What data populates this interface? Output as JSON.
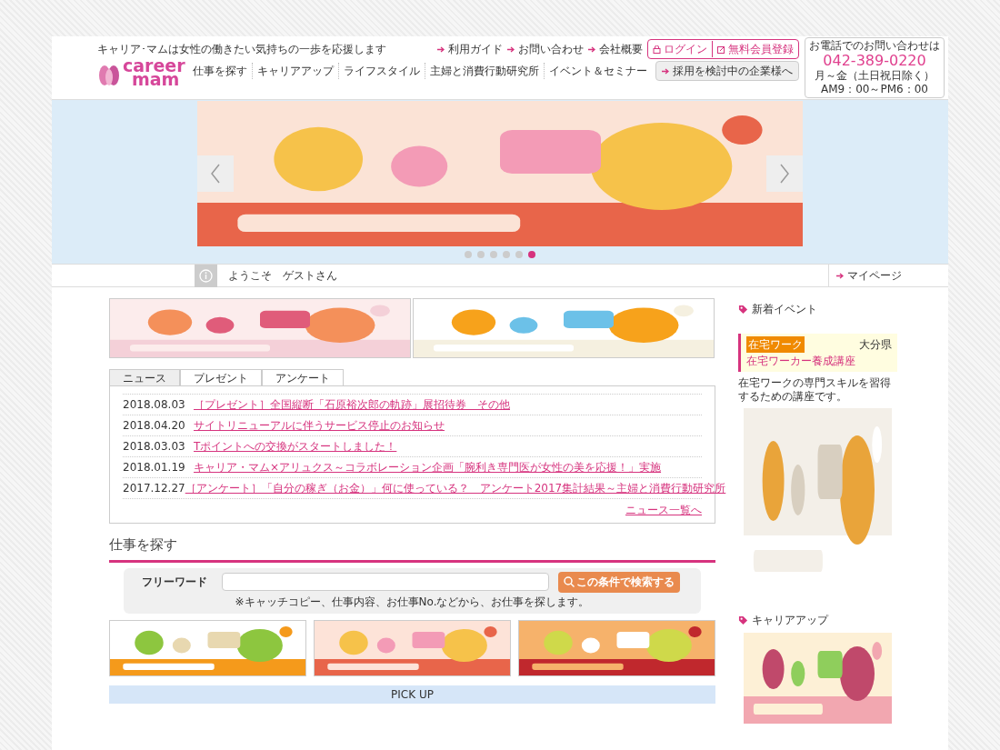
{
  "header": {
    "tagline": "キャリア･マムは女性の働きたい気持ちの一歩を応援します",
    "logo": [
      "career",
      "mam"
    ],
    "top_links": [
      "利用ガイド",
      "お問い合わせ",
      "会社概要"
    ],
    "login": "ログイン",
    "register": "無料会員登録",
    "nav": [
      "仕事を探す",
      "キャリアアップ",
      "ライフスタイル",
      "主婦と消費行動研究所",
      "イベント＆セミナー"
    ],
    "company_button": "採用を検討中の企業様へ",
    "contact": {
      "title": "お電話でのお問い合わせは",
      "phone": "042-389-0220",
      "days": "月～金（土日祝日除く）",
      "hours": "AM9：00～PM6：00"
    }
  },
  "carousel": {
    "dots": [
      {
        "selected": false
      },
      {
        "selected": false
      },
      {
        "selected": false
      },
      {
        "selected": false
      },
      {
        "selected": false
      },
      {
        "selected": true
      }
    ]
  },
  "welcome": {
    "text": "ようこそ　ゲストさん",
    "mypage": "マイページ"
  },
  "tabs": [
    {
      "label": "ニュース",
      "selected": true
    },
    {
      "label": "プレゼント",
      "selected": false
    },
    {
      "label": "アンケート",
      "selected": false
    }
  ],
  "news": [
    {
      "date": "2018.08.03",
      "title": "［プレゼント］全国縦断「石原裕次郎の軌跡」展招待券　その他"
    },
    {
      "date": "2018.04.20",
      "title": "サイトリニューアルに伴うサービス停止のお知らせ"
    },
    {
      "date": "2018.03.03",
      "title": "Tポイントへの交換がスタートしました！"
    },
    {
      "date": "2018.01.19",
      "title": "キャリア・マム×アリュクス～コラボレーション企画「腕利き専門医が女性の美を応援！」実施"
    },
    {
      "date": "2017.12.27",
      "title": "［アンケート］「自分の稼ぎ（お金）」何に使っている？　アンケート2017集計結果～主婦と消費行動研究所"
    }
  ],
  "news_more": "ニュース一覧へ",
  "job_search": {
    "heading": "仕事を探す",
    "label": "フリーワード",
    "button": "この条件で検索する",
    "note": "※キャッチコピー、仕事内容、お仕事No.などから、お仕事を探します。"
  },
  "pickup": "PICK UP",
  "sidebar": {
    "events_heading": "新着イベント",
    "event": {
      "tag": "在宅ワーク",
      "region": "大分県",
      "title": "在宅ワーカー養成講座",
      "description": "在宅ワークの専門スキルを習得するための講座です。"
    },
    "career_heading": "キャリアアップ"
  }
}
